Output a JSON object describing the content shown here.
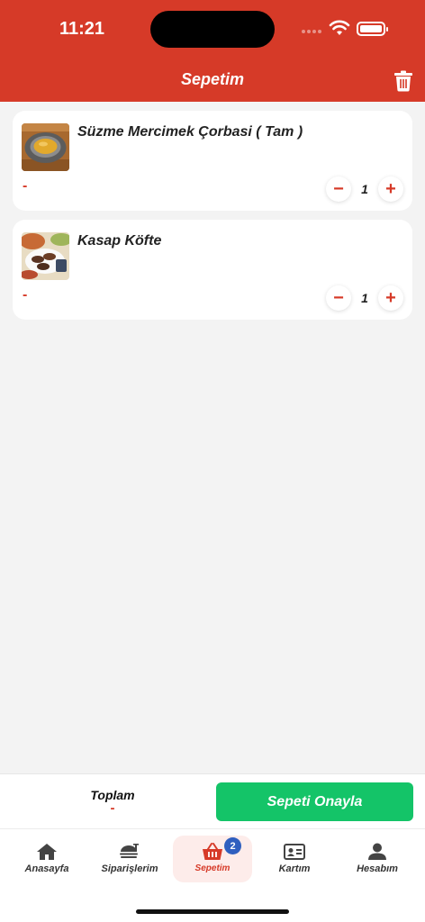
{
  "status_bar": {
    "time": "11:21"
  },
  "header": {
    "title": "Sepetim"
  },
  "cart": {
    "items": [
      {
        "name": "Süzme Mercimek Çorbasi ( Tam )",
        "price": "-",
        "quantity": "1"
      },
      {
        "name": "Kasap Köfte",
        "price": "-",
        "quantity": "1"
      }
    ],
    "minus": "−",
    "plus": "+"
  },
  "summary": {
    "total_label": "Toplam",
    "total_value": "-",
    "confirm_label": "Sepeti Onayla"
  },
  "tabbar": {
    "tabs": [
      {
        "label": "Anasayfa"
      },
      {
        "label": "Siparişlerim"
      },
      {
        "label": "Sepetim",
        "badge": "2"
      },
      {
        "label": "Kartım"
      },
      {
        "label": "Hesabım"
      }
    ]
  },
  "colors": {
    "primary": "#d63a28",
    "confirm": "#14c468",
    "badge": "#2f5fbf",
    "background": "#f3f3f3"
  }
}
